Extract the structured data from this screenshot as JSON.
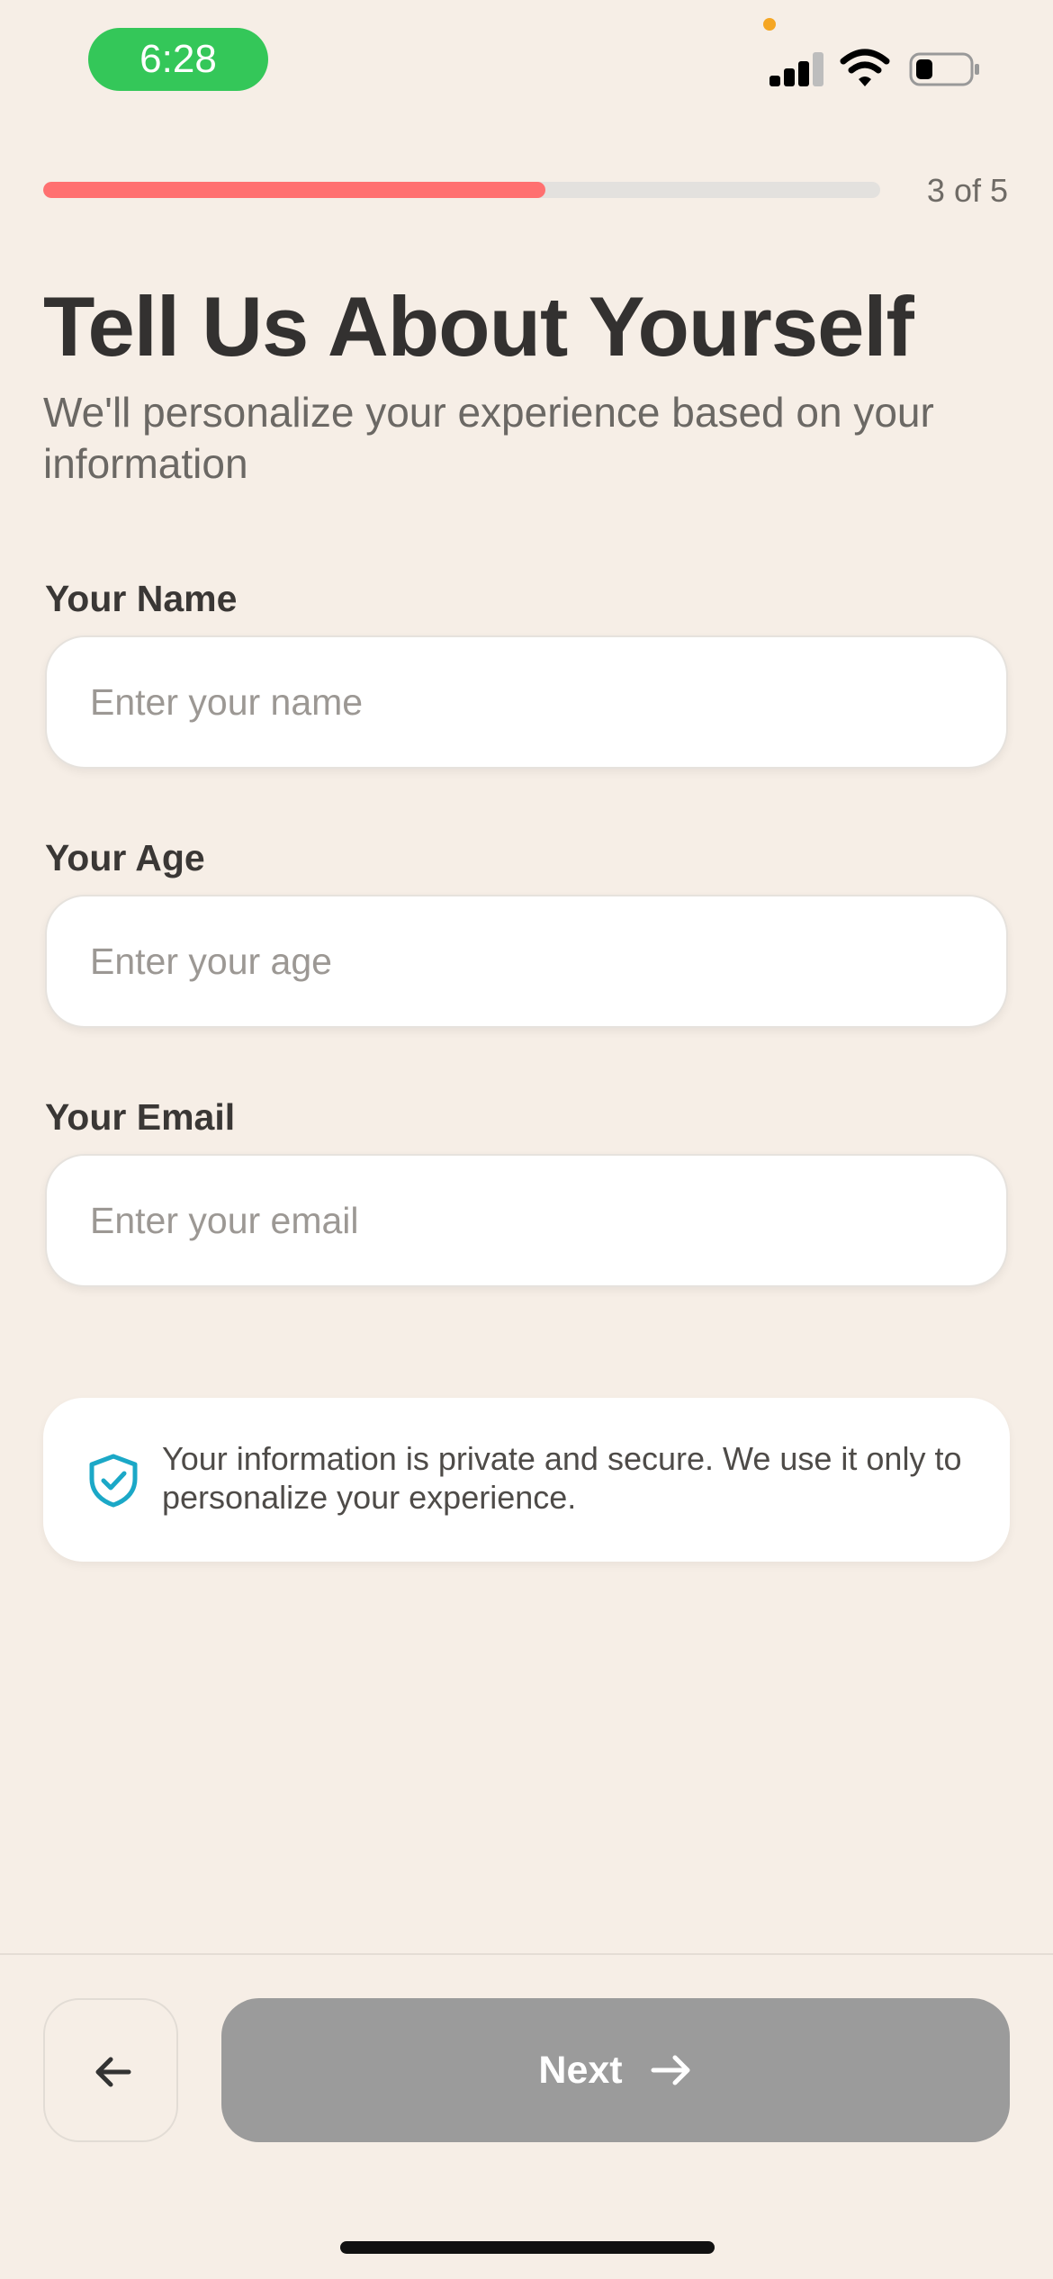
{
  "status_bar": {
    "time": "6:28",
    "icons": [
      "signal-icon",
      "wifi-icon",
      "battery-icon"
    ],
    "time_pill_color": "#34C759"
  },
  "progress": {
    "label": "3 of 5",
    "current_step": 3,
    "total_steps": 5,
    "fill_fraction": 0.6,
    "fill_color": "#FF7070"
  },
  "header": {
    "title": "Tell Us About Yourself",
    "subtitle": "We'll personalize your experience based on your information"
  },
  "form": {
    "name": {
      "label": "Your Name",
      "placeholder": "Enter your name",
      "value": ""
    },
    "age": {
      "label": "Your Age",
      "placeholder": "Enter your age",
      "value": ""
    },
    "email": {
      "label": "Your Email",
      "placeholder": "Enter your email",
      "value": ""
    }
  },
  "privacy": {
    "icon": "shield-check-icon",
    "icon_color": "#1BA8C7",
    "text": "Your information is private and secure. We use it only to personalize your experience."
  },
  "footer": {
    "back_icon": "arrow-left-icon",
    "next_label": "Next",
    "next_icon": "arrow-right-icon",
    "next_color": "#9B9B9B"
  }
}
